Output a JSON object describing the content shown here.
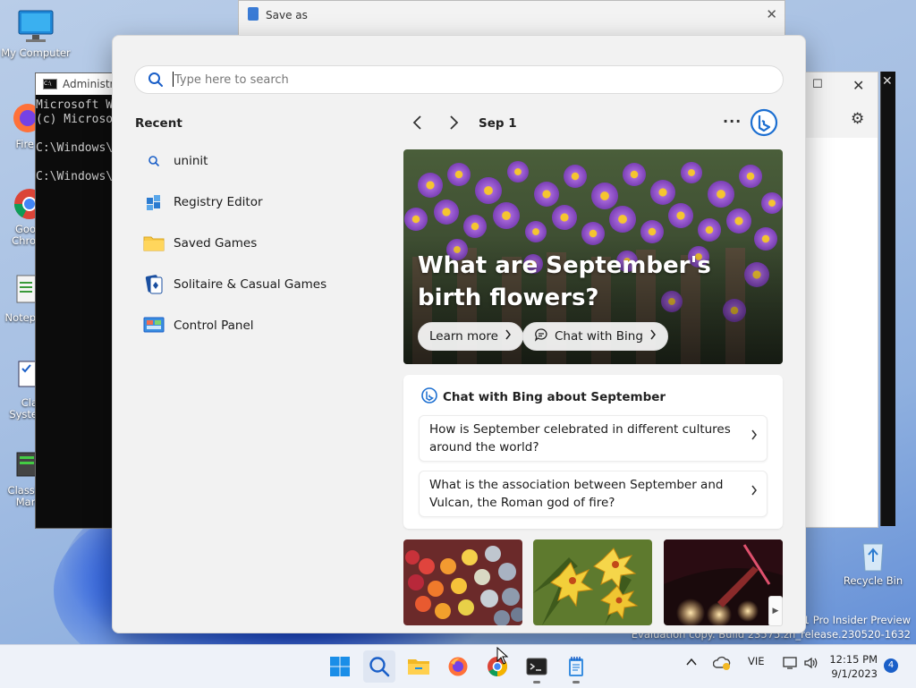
{
  "desktop": {
    "icons": [
      {
        "label": "My Computer"
      },
      {
        "label": "Fire"
      },
      {
        "label": "Goo\nChro"
      },
      {
        "label": "Notep"
      },
      {
        "label": "Cla\nSyste"
      },
      {
        "label": "Classi\nMan"
      },
      {
        "label": "Recycle Bin"
      }
    ],
    "watermark": {
      "line1": "11 Pro Insider Preview",
      "line2": "Evaluation copy. Build 23575.zn_release.230520-1632"
    }
  },
  "background_windows": {
    "cmd": {
      "title": "Administra",
      "lines": "Microsoft W\n(c) Microso\n\nC:\\Windows\\\n\nC:\\Windows\\"
    },
    "save_as": {
      "title": "Save as"
    }
  },
  "search": {
    "placeholder": "Type here to search",
    "value": ""
  },
  "recent": {
    "heading": "Recent",
    "items": [
      {
        "label": "uninit",
        "icon": "search-icon"
      },
      {
        "label": "Registry Editor",
        "icon": "registry-editor-icon"
      },
      {
        "label": "Saved Games",
        "icon": "folder-icon"
      },
      {
        "label": "Solitaire & Casual Games",
        "icon": "solitaire-icon"
      },
      {
        "label": "Control Panel",
        "icon": "control-panel-icon"
      }
    ]
  },
  "highlights": {
    "date": "Sep 1",
    "more": "···",
    "hero": {
      "title": "What are September's birth flowers?",
      "learn_more": "Learn more",
      "chat_with_bing": "Chat with Bing"
    },
    "chat_card": {
      "heading": "Chat with Bing about September",
      "questions": [
        {
          "text": "How is September celebrated in different cultures around the world?"
        },
        {
          "text": "What is the association between September and Vulcan, the Roman god of fire?"
        }
      ]
    }
  },
  "taskbar": {
    "language": "VIE",
    "time": "12:15 PM",
    "date": "9/1/2023",
    "notification_count": "4"
  },
  "colors": {
    "accent": "#1a5fc8",
    "bing": "#1c6fd1",
    "flyout_bg": "#f2f2f2"
  }
}
